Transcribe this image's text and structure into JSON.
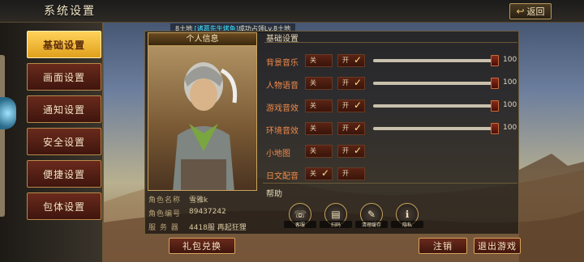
{
  "header": {
    "title": "系统设置",
    "back_label": "返回"
  },
  "ticker": {
    "prefix": "8土地",
    "name": "[诸葛先生烤鱼]",
    "message": "成功占领Lv.8土地"
  },
  "sidebar": {
    "items": [
      {
        "label": "基础设置",
        "active": true
      },
      {
        "label": "画面设置",
        "active": false
      },
      {
        "label": "通知设置",
        "active": false
      },
      {
        "label": "安全设置",
        "active": false
      },
      {
        "label": "便捷设置",
        "active": false
      },
      {
        "label": "包体设置",
        "active": false
      }
    ]
  },
  "profile": {
    "title": "个人信息",
    "name_label": "角色名称",
    "name_value": "雪雅k",
    "id_label": "角色编号",
    "id_value": "89437242",
    "server_label": "服 务 器",
    "server_value": "4418服 再起狂狸",
    "gift_button": "礼包兑换"
  },
  "settings": {
    "section_title": "基础设置",
    "off_label": "关",
    "on_label": "开",
    "rows": [
      {
        "label": "背景音乐",
        "state": "on",
        "value": 100
      },
      {
        "label": "人物语音",
        "state": "on",
        "value": 100
      },
      {
        "label": "游戏音效",
        "state": "on",
        "value": 100
      },
      {
        "label": "环境音效",
        "state": "on",
        "value": 100
      },
      {
        "label": "小地图",
        "state": "on"
      },
      {
        "label": "日文配音",
        "state": "off"
      }
    ]
  },
  "help": {
    "title": "帮助",
    "items": [
      {
        "label": "客服",
        "icon": "headset-icon"
      },
      {
        "label": "扫码",
        "icon": "scan-icon"
      },
      {
        "label": "清理缓存",
        "icon": "broom-icon"
      },
      {
        "label": "隐私",
        "icon": "info-icon"
      }
    ]
  },
  "footer": {
    "logout": "注销",
    "exit": "退出游戏"
  },
  "colors": {
    "accent": "#ffd25a",
    "label_orange": "#f08a4a",
    "gold_border": "#c9a45c"
  }
}
